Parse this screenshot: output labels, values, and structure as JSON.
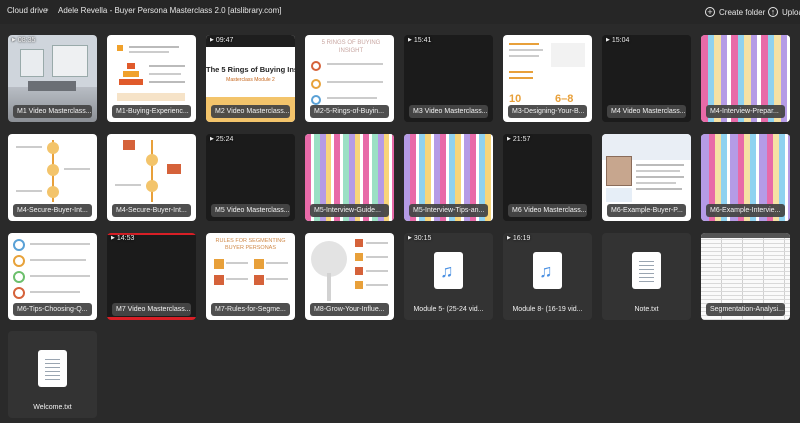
{
  "breadcrumb": {
    "root": "Cloud drive",
    "separator": "›",
    "current": "Adele Revella - Buyer Persona Masterclass 2.0 [atslibrary.com]"
  },
  "toolbar": {
    "create_folder": "Create folder",
    "upload": "Upload"
  },
  "icons": {
    "create_folder": "plus-circle-icon",
    "upload": "upload-arrow-icon",
    "video": "play-icon",
    "audio": "music-note-icon",
    "text": "text-document-icon"
  },
  "colors": {
    "background": "#2a2a2a",
    "tile_label": "#464646",
    "accent_red": "#d81f26",
    "audio_blue": "#4a90e2"
  },
  "items": [
    {
      "name": "M1 Video Masterclass...",
      "duration": "08:35",
      "kind": "video"
    },
    {
      "name": "M1-Buying-Experienc...",
      "kind": "image"
    },
    {
      "name": "M2 Video Masterclass...",
      "duration": "09:47",
      "kind": "video",
      "thumb_title": "The 5 Rings of Buying Insight",
      "thumb_subtitle": "Masterclass Module 2"
    },
    {
      "name": "M2-5-Rings-of-Buyin...",
      "kind": "image",
      "thumb_title": "5 RINGS OF BUYING INSIGHT"
    },
    {
      "name": "M3 Video Masterclass...",
      "duration": "15:41",
      "kind": "video"
    },
    {
      "name": "M3-Designing-Your-B...",
      "kind": "image",
      "thumb_numbers": [
        "10",
        "6–8"
      ]
    },
    {
      "name": "M4 Video Masterclass...",
      "duration": "15:04",
      "kind": "video"
    },
    {
      "name": "M4-Interview-Prepar...",
      "kind": "image"
    },
    {
      "name": "M4-Secure-Buyer-Int...",
      "kind": "image"
    },
    {
      "name": "M4-Secure-Buyer-Int...",
      "kind": "image"
    },
    {
      "name": "M5 Video Masterclass...",
      "duration": "25:24",
      "kind": "video"
    },
    {
      "name": "M5-Interview-Guide...",
      "kind": "image"
    },
    {
      "name": "M5-Interview-Tips-an...",
      "kind": "image"
    },
    {
      "name": "M6 Video Masterclass...",
      "duration": "21:57",
      "kind": "video"
    },
    {
      "name": "M6-Example-Buyer-P...",
      "kind": "image"
    },
    {
      "name": "M6-Example-Intervie...",
      "kind": "image"
    },
    {
      "name": "M6-Tips-Choosing-Q...",
      "kind": "image"
    },
    {
      "name": "M7 Video Masterclass...",
      "duration": "14:53",
      "kind": "video"
    },
    {
      "name": "M7-Rules-for-Segme...",
      "kind": "image",
      "thumb_title": "RULES FOR SEGMENTING BUYER PERSONAS"
    },
    {
      "name": "M8-Grow-Your-Influe...",
      "kind": "image"
    },
    {
      "name": "Module 5- (25-24 vid...",
      "duration": "30:15",
      "kind": "audio"
    },
    {
      "name": "Module 8- (16-19 vid...",
      "duration": "16:19",
      "kind": "audio"
    },
    {
      "name": "Note.txt",
      "kind": "text"
    },
    {
      "name": "Segmentation-Analysi...",
      "kind": "image"
    },
    {
      "name": "Welcome.txt",
      "kind": "text"
    }
  ]
}
